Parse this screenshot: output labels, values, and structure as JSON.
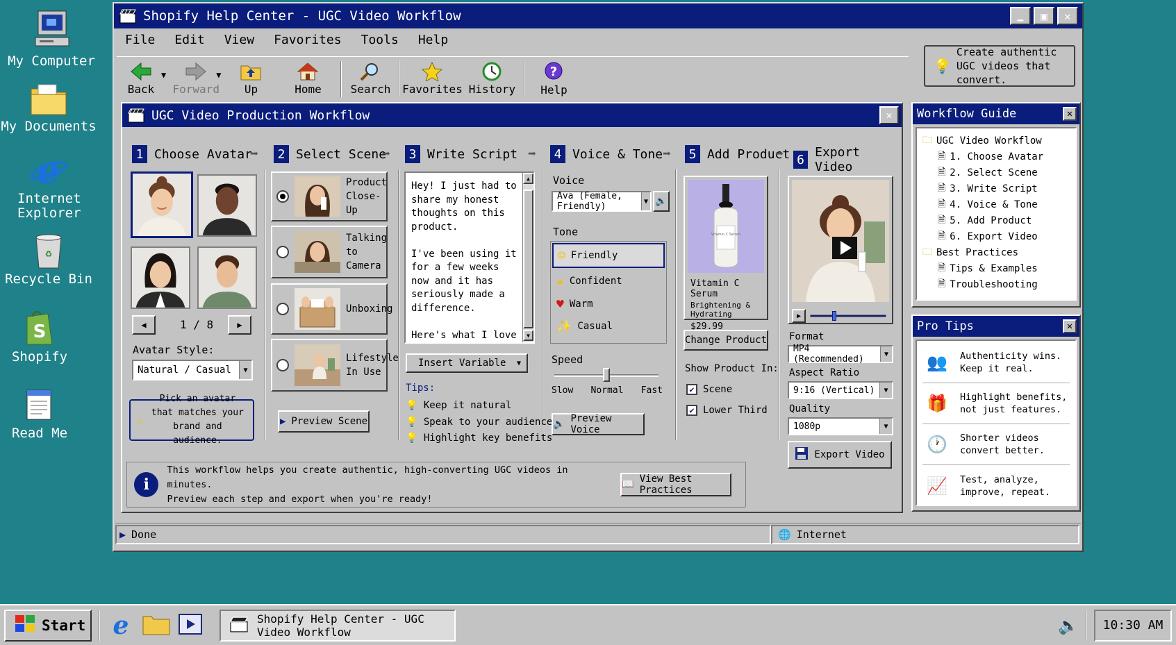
{
  "desktop": {
    "icons": [
      "My Computer",
      "My Documents",
      "Internet Explorer",
      "Recycle Bin",
      "Shopify",
      "Read Me"
    ]
  },
  "window": {
    "title": "Shopify Help Center - UGC Video Workflow",
    "menu": [
      "File",
      "Edit",
      "View",
      "Favorites",
      "Tools",
      "Help"
    ],
    "toolbar": [
      "Back",
      "Forward",
      "Up",
      "Home",
      "Search",
      "Favorites",
      "History",
      "Help"
    ],
    "tip": "Create authentic UGC videos that convert.",
    "status": {
      "left": "Done",
      "right": "Internet"
    }
  },
  "workflow": {
    "title": "UGC Video Production Workflow",
    "steps": [
      {
        "num": "1",
        "label": "Choose Avatar"
      },
      {
        "num": "2",
        "label": "Select Scene"
      },
      {
        "num": "3",
        "label": "Write Script"
      },
      {
        "num": "4",
        "label": "Voice & Tone"
      },
      {
        "num": "5",
        "label": "Add Product"
      },
      {
        "num": "6",
        "label": "Export Video"
      }
    ],
    "avatar": {
      "pager": "1 / 8",
      "style_label": "Avatar Style:",
      "style_value": "Natural / Casual",
      "hint": "Pick an avatar that matches your brand and audience."
    },
    "scenes": [
      {
        "label": "Product Close-Up",
        "selected": true
      },
      {
        "label": "Talking to Camera",
        "selected": false
      },
      {
        "label": "Unboxing",
        "selected": false
      },
      {
        "label": "Lifestyle In Use",
        "selected": false
      }
    ],
    "preview_scene": "Preview Scene",
    "script": {
      "text": "Hey! I just had to share my honest thoughts on this product.\n\nI've been using it for a few weeks now and it has seriously made a difference.\n\nHere's what I love about it...",
      "insert_variable": "Insert Variable",
      "tips_label": "Tips:",
      "tips": [
        "Keep it natural",
        "Speak to your audience",
        "Highlight key benefits"
      ]
    },
    "voice": {
      "label": "Voice",
      "value": "Ava (Female, Friendly)",
      "tone_label": "Tone",
      "tones": [
        "Friendly",
        "Confident",
        "Warm",
        "Casual"
      ],
      "speed_label": "Speed",
      "speed_marks": [
        "Slow",
        "Normal",
        "Fast"
      ],
      "speed_level": 0.5,
      "preview": "Preview Voice"
    },
    "product": {
      "bottle_label": "Vitamin C Serum",
      "name": "Vitamin C Serum",
      "subtitle": "Brightening & Hydrating",
      "price": "$29.99",
      "change": "Change Product",
      "show_label": "Show Product In:",
      "show_options": [
        {
          "label": "Scene",
          "checked": true
        },
        {
          "label": "Lower Third",
          "checked": true
        }
      ]
    },
    "export": {
      "format_label": "Format",
      "format_value": "MP4 (Recommended)",
      "aspect_label": "Aspect Ratio",
      "aspect_value": "9:16 (Vertical)",
      "quality_label": "Quality",
      "quality_value": "1080p",
      "button": "Export Video",
      "progress": 0.3
    },
    "info": {
      "line1": "This workflow helps you create authentic, high-converting UGC videos in minutes.",
      "line2": "Preview each step and export when you're ready!",
      "button": "View Best Practices"
    }
  },
  "guide": {
    "title": "Workflow Guide",
    "root": "UGC Video Workflow",
    "items": [
      "1. Choose Avatar",
      "2. Select Scene",
      "3. Write Script",
      "4. Voice & Tone",
      "5. Add Product",
      "6. Export Video"
    ],
    "root2": "Best Practices",
    "items2": [
      "Tips & Examples",
      "Troubleshooting"
    ]
  },
  "pro_tips": {
    "title": "Pro Tips",
    "tips": [
      {
        "l1": "Authenticity wins.",
        "l2": "Keep it real."
      },
      {
        "l1": "Highlight benefits,",
        "l2": "not just features."
      },
      {
        "l1": "Shorter videos",
        "l2": "convert better."
      },
      {
        "l1": "Test, analyze,",
        "l2": "improve, repeat."
      }
    ]
  },
  "taskbar": {
    "start": "Start",
    "task": "Shopify Help Center - UGC Video Workflow",
    "clock": "10:30 AM"
  }
}
